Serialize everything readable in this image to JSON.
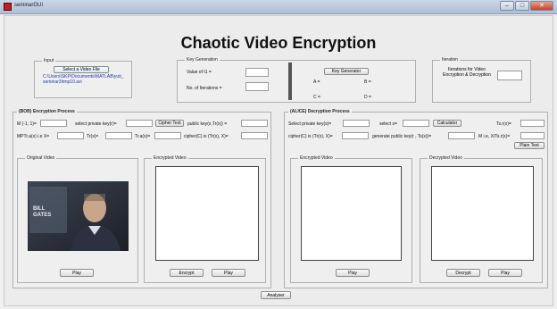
{
  "window": {
    "title": "seminarGUI"
  },
  "main_title": "Chaotic Video Encryption",
  "input_panel": {
    "label": "Input",
    "select_button": "Select a Video File",
    "path": "C:\\Users\\SKP\\Documents\\MATLAB\\yuti_seminar3\\tmp10.avi"
  },
  "keygen_panel": {
    "label": "Key Generation",
    "value_label": "Value of t1 =",
    "iter_label": "No. of Iterations =",
    "button": "Key Generator",
    "a_label": "A =",
    "b_label": "B =",
    "c_label": "C =",
    "d_label": "D ="
  },
  "iteration_panel": {
    "label": "Iteration",
    "text": "Iterations for Video Encryption & Decryption"
  },
  "bob": {
    "label": "(BOB) Encryption Process",
    "m_label": "M (-1, 1)=",
    "private_key_label": "select private key(r)=",
    "cipher_button": "Cipher Text",
    "public_key_label": "public key(x,Tr(x)) =",
    "mptr_label": "MPTr.a(x) i.e X=",
    "tr_label": "Tr(x)=",
    "tra_label": "Tr.a(x)=",
    "cipher_label": "cipher(C) is (Tr(x), X)=",
    "original_panel": "Original Video",
    "encrypted_panel": "Encrypted Video",
    "play1": "Play",
    "encrypt": "Encrypt",
    "play2": "Play",
    "video_overlay": "BILL GATES"
  },
  "alice": {
    "label": "(ALICE) Decryption Process",
    "private_key_label": "Select private key(s)=",
    "select_s_label": "select s=",
    "calc_button": "Calculator",
    "ts_label": "Ts.r(x)=",
    "cipher_label": "cipher(C) is (Tr(x), X)=",
    "gen_pub_label": "generate public key(r , Ts(x))=",
    "m_label": "M i.e, X/Ts.r(x)=",
    "plain_button": "Plain Text",
    "encrypted_panel": "Encrypted Video",
    "decrypted_panel": "Decrypted Video",
    "play1": "Play",
    "decrypt": "Decrypt",
    "play2": "Play"
  },
  "analyser_button": "Analyser"
}
